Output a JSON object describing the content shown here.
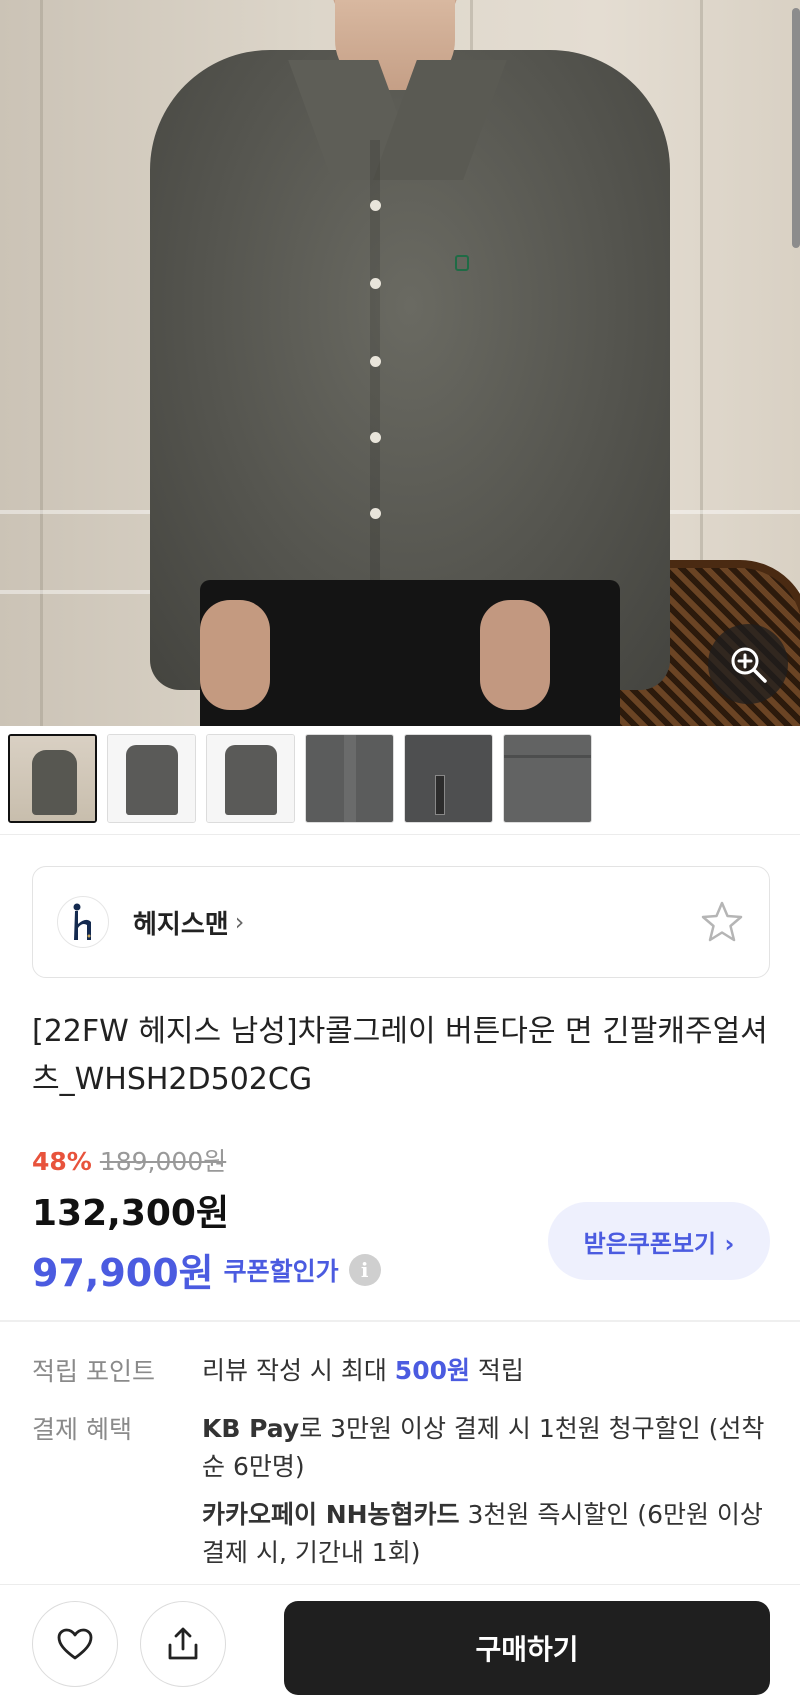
{
  "product": {
    "brand": {
      "name": "헤지스맨",
      "chevron": "›"
    },
    "title": "[22FW 헤지스 남성]차콜그레이 버튼다운 면 긴팔캐주얼셔츠_WHSH2D502CG",
    "price": {
      "discount_rate": "48%",
      "original_price": "189,000원",
      "sale_price": "132,300원",
      "coupon_price": "97,900원",
      "coupon_label": "쿠폰할인가",
      "info_glyph": "i"
    },
    "coupon_button": "받은쿠폰보기 ›"
  },
  "gallery": {
    "thumbnails": [
      "thumb-1",
      "thumb-2",
      "thumb-3",
      "thumb-4",
      "thumb-5",
      "thumb-6"
    ],
    "active_index": 0
  },
  "benefits": {
    "points": {
      "label": "적립 포인트",
      "prefix": "리뷰 작성 시 최대 ",
      "amount": "500원",
      "suffix": " 적립"
    },
    "payment": {
      "label": "결제 혜택",
      "items": [
        {
          "strong": "KB Pay",
          "text": "로 3만원 이상 결제 시 1천원 청구할인 (선착순 6만명)"
        },
        {
          "strong": "카카오페이 NH농협카드",
          "text": " 3천원 즉시할인 (6만원 이상 결제 시, 기간내 1회)"
        }
      ]
    }
  },
  "bottom_bar": {
    "buy_label": "구매하기"
  },
  "colors": {
    "discount": "#e8533c",
    "accent": "#4b5be0",
    "buy_button": "#1f1f1f"
  },
  "icons": [
    "zoom-in-icon",
    "star-outline-icon",
    "heart-outline-icon",
    "share-icon",
    "info-icon",
    "chevron-right-icon"
  ]
}
